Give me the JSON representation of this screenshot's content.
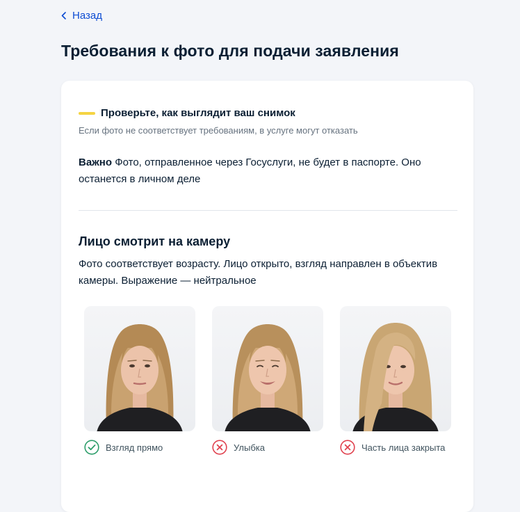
{
  "nav": {
    "back_label": "Назад"
  },
  "page": {
    "title": "Требования к фото для подачи заявления"
  },
  "notice": {
    "title": "Проверьте, как выглядит ваш снимок",
    "subtitle": "Если фото не соответствует требованиям, в услуге могут отказать"
  },
  "important": {
    "label": "Важно",
    "text": " Фото, отправленное через Госуслуги, не будет в паспорте. Оно останется в личном деле"
  },
  "section": {
    "title": "Лицо смотрит на камеру",
    "description": "Фото соответствует возрасту. Лицо открыто, взгляд направлен в объектив камеры. Выражение — нейтральное"
  },
  "examples": [
    {
      "caption": "Взгляд прямо",
      "status": "ok",
      "icon": "check-circle-icon"
    },
    {
      "caption": "Улыбка",
      "status": "bad",
      "icon": "cross-circle-icon"
    },
    {
      "caption": "Часть лица закрыта",
      "status": "bad",
      "icon": "cross-circle-icon"
    }
  ],
  "colors": {
    "link": "#0d4cd3",
    "accent": "#f5d443",
    "ok": "#2e9e6b",
    "bad": "#e0424f",
    "background": "#f3f5f9"
  }
}
